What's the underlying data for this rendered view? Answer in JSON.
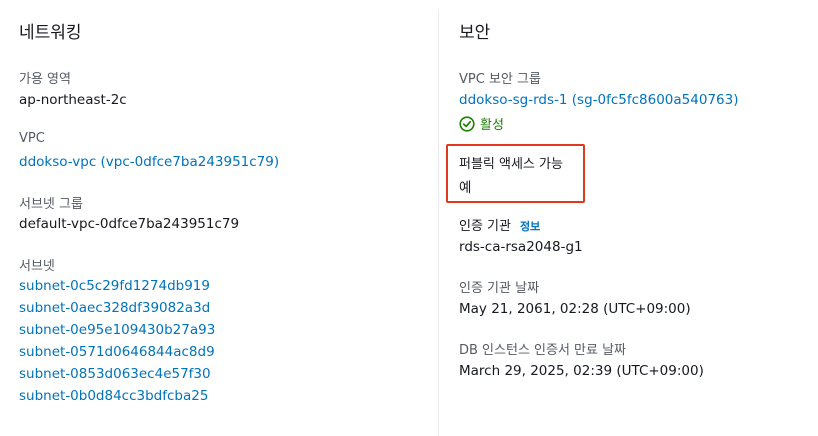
{
  "networking": {
    "title": "네트워킹",
    "availability_zone_label": "가용 영역",
    "availability_zone_value": "ap-northeast-2c",
    "vpc_label": "VPC",
    "vpc_value": "ddokso-vpc (vpc-0dfce7ba243951c79)",
    "subnet_group_label": "서브넷 그룹",
    "subnet_group_value": "default-vpc-0dfce7ba243951c79",
    "subnets_label": "서브넷",
    "subnets": [
      "subnet-0c5c29fd1274db919",
      "subnet-0aec328df39082a3d",
      "subnet-0e95e109430b27a93",
      "subnet-0571d0646844ac8d9",
      "subnet-0853d063ec4e57f30",
      "subnet-0b0d84cc3bdfcba25"
    ]
  },
  "security": {
    "title": "보안",
    "vpc_sg_label": "VPC 보안 그룹",
    "vpc_sg_value": "ddokso-sg-rds-1 (sg-0fc5fc8600a540763)",
    "vpc_sg_status": "활성",
    "public_access_label": "퍼블릭 액세스 가능",
    "public_access_value": "예",
    "ca_label": "인증 기관",
    "ca_info_link": "정보",
    "ca_value": "rds-ca-rsa2048-g1",
    "ca_date_label": "인증 기관 날짜",
    "ca_date_value": "May 21, 2061, 02:28 (UTC+09:00)",
    "db_cert_expiry_label": "DB 인스턴스 인증서 만료 날짜",
    "db_cert_expiry_value": "March 29, 2025, 02:39 (UTC+09:00)"
  },
  "colors": {
    "link": "#0073bb",
    "status_active": "#1d8102",
    "highlight_border": "#e0391b"
  }
}
